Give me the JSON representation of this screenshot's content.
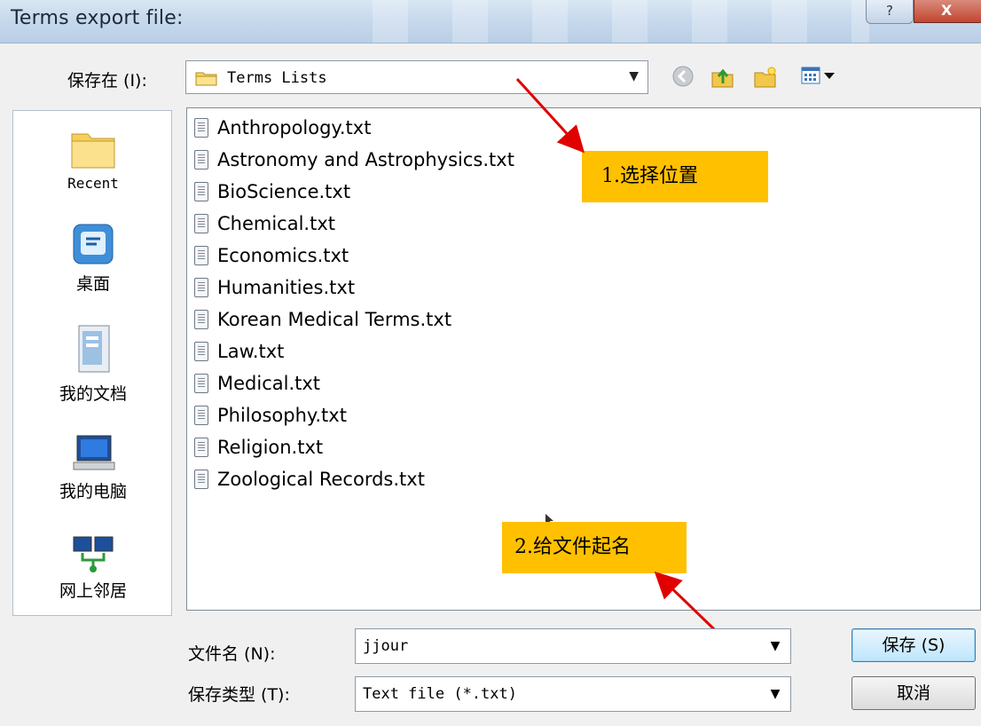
{
  "window": {
    "title": "Terms export file:",
    "help_label": "?",
    "close_label": "X"
  },
  "toolbar": {
    "save_in_label": "保存在 (I):",
    "save_in_value": "Terms Lists"
  },
  "places": [
    {
      "label": "Recent",
      "icon": "recent-folder-icon"
    },
    {
      "label": "桌面",
      "icon": "desktop-icon"
    },
    {
      "label": "我的文档",
      "icon": "my-documents-icon"
    },
    {
      "label": "我的电脑",
      "icon": "my-computer-icon"
    },
    {
      "label": "网上邻居",
      "icon": "network-icon"
    }
  ],
  "files": [
    "Anthropology.txt",
    "Astronomy and Astrophysics.txt",
    "BioScience.txt",
    "Chemical.txt",
    "Economics.txt",
    "Humanities.txt",
    "Korean Medical Terms.txt",
    "Law.txt",
    "Medical.txt",
    "Philosophy.txt",
    "Religion.txt",
    "Zoological Records.txt"
  ],
  "annotations": {
    "step1": "1.选择位置",
    "step2": "2.给文件起名",
    "color": "#ffc000",
    "arrow_color": "#e00000"
  },
  "form": {
    "filename_label": "文件名 (N):",
    "filename_value": "jjour",
    "filetype_label": "保存类型 (T):",
    "filetype_value": "Text file (*.txt)",
    "save_button": "保存 (S)",
    "cancel_button": "取消"
  }
}
